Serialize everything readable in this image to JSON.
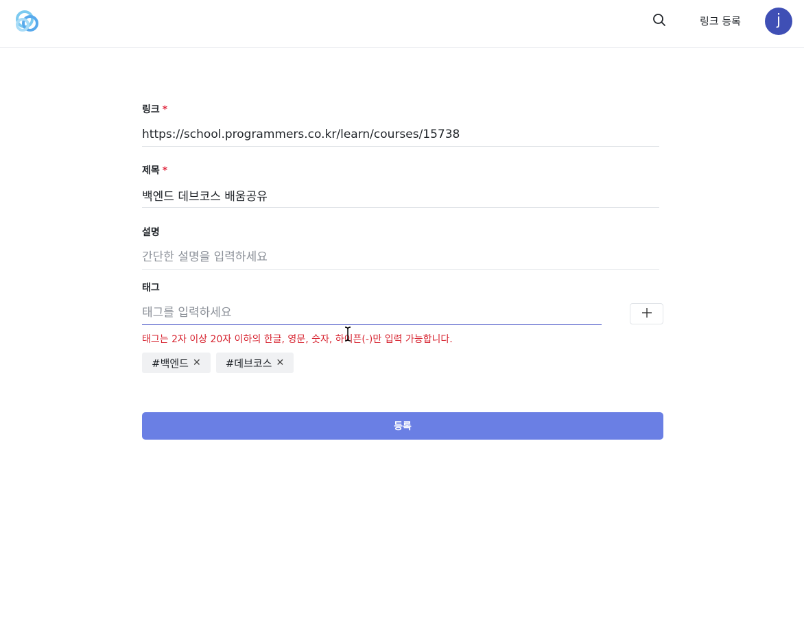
{
  "header": {
    "logo_icon": "cloud-logo-icon",
    "search_icon": "search-icon",
    "register_link": "링크 등록",
    "avatar_initial": "j"
  },
  "form": {
    "link": {
      "label": "링크",
      "required_mark": "*",
      "value": "https://school.programmers.co.kr/learn/courses/15738"
    },
    "title": {
      "label": "제목",
      "required_mark": "*",
      "value": "백엔드 데브코스 배움공유"
    },
    "description": {
      "label": "설명",
      "placeholder": "간단한 설명을 입력하세요",
      "value": ""
    },
    "tags": {
      "label": "태그",
      "placeholder": "태그를 입력하세요",
      "value": "",
      "add_icon": "plus-icon",
      "error": "태그는 2자 이상 20자 이하의 한글, 영문, 숫자, 하이픈(-)만 입력 가능합니다.",
      "items": [
        {
          "label": "#백엔드",
          "remove": "✕"
        },
        {
          "label": "#데브코스",
          "remove": "✕"
        }
      ]
    },
    "submit_label": "등록"
  },
  "colors": {
    "accent": "#6a7fe4",
    "avatar": "#3f4fb5",
    "error": "#d72430",
    "required": "#e0243b"
  }
}
